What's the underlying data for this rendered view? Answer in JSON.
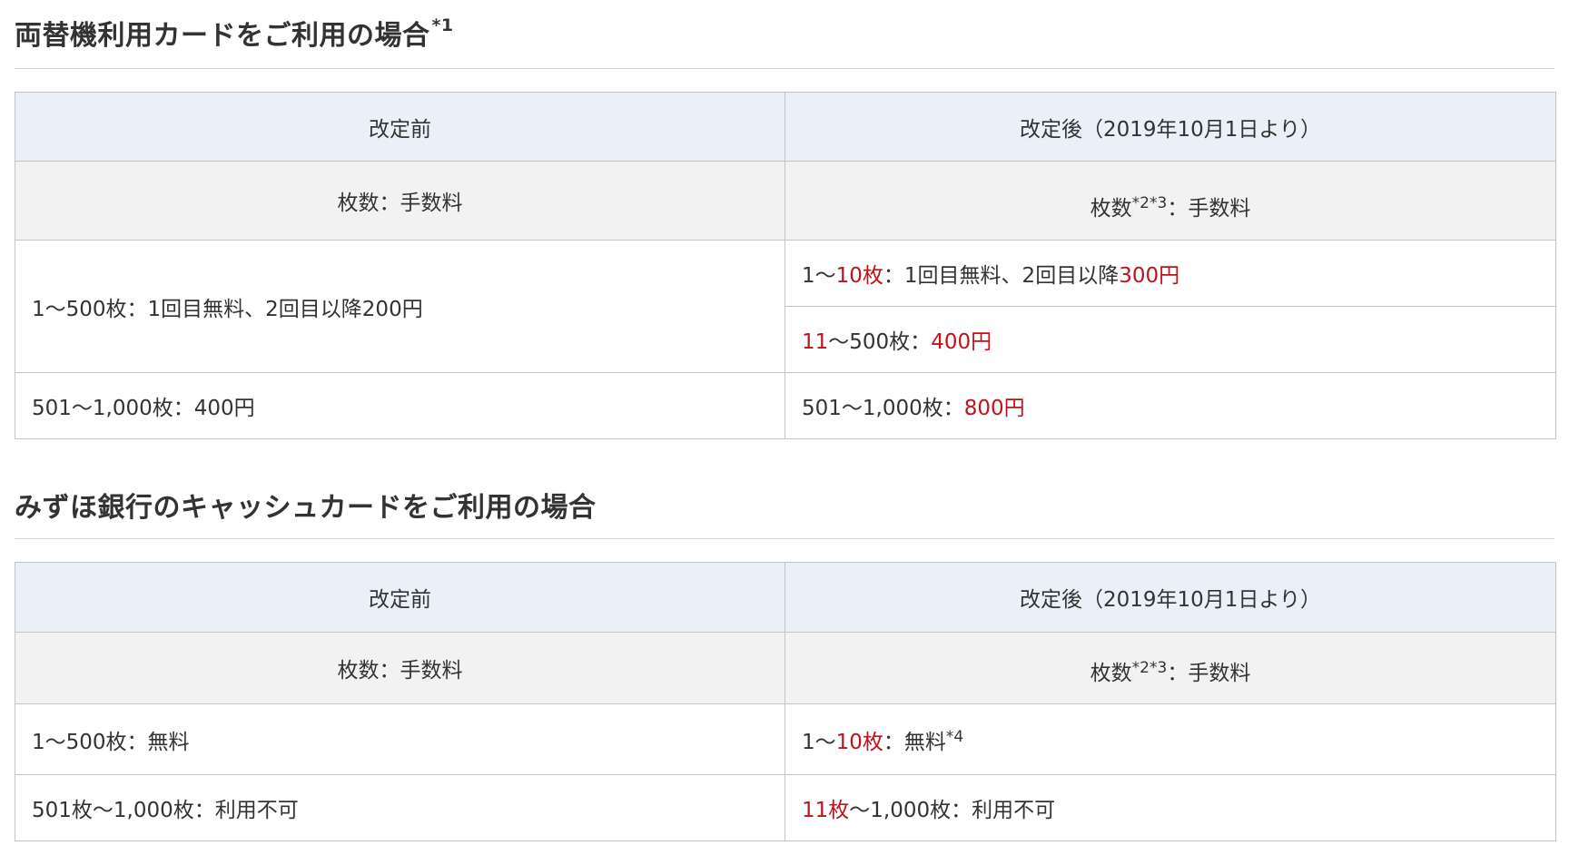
{
  "section1": {
    "title": "両替機利用カードをご利用の場合",
    "title_note": "*1",
    "header": {
      "before": "改定前",
      "after": "改定後（2019年10月1日より）"
    },
    "subheader": {
      "before": "枚数：手数料",
      "after_label": "枚数",
      "after_note": "*2*3",
      "after_rest": "：手数料"
    },
    "rows": {
      "before_1": "1～500枚：1回目無料、2回目以降200円",
      "after_1": {
        "a": "1～",
        "b": "10枚",
        "c": "：1回目無料、2回目以降",
        "d": "300円"
      },
      "after_2": {
        "a": "11",
        "b": "～500枚：",
        "c": "400円"
      },
      "before_2": "501～1,000枚：400円",
      "after_3": {
        "a": "501～1,000枚：",
        "b": "800円"
      }
    }
  },
  "section2": {
    "title": "みずほ銀行のキャッシュカードをご利用の場合",
    "header": {
      "before": "改定前",
      "after": "改定後（2019年10月1日より）"
    },
    "subheader": {
      "before": "枚数：手数料",
      "after_label": "枚数",
      "after_note": "*2*3",
      "after_rest": "：手数料"
    },
    "rows": {
      "before_1": "1～500枚：無料",
      "after_1": {
        "a": "1～",
        "b": "10枚",
        "c": "：無料",
        "note": "*4"
      },
      "before_2": "501枚～1,000枚：利用不可",
      "after_2": {
        "a": "11枚",
        "b": "～1,000枚：利用不可"
      }
    }
  },
  "colors": {
    "header_bg": "#e9f0f7",
    "subheader_bg": "#f2f2f2",
    "highlight": "#c0121a",
    "border": "#c4c4c4"
  }
}
